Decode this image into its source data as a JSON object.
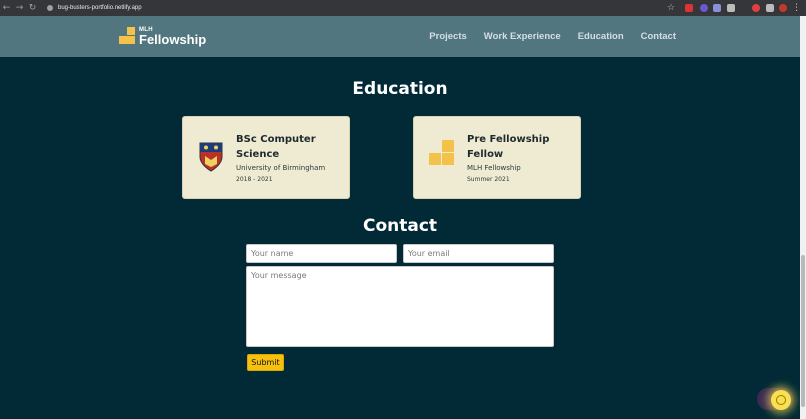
{
  "browser": {
    "url": "bug-busters-portfolio.netlify.app",
    "back_icon": "arrow-left-icon",
    "forward_icon": "arrow-right-icon",
    "reload_icon": "reload-icon",
    "star_glyph": "☆",
    "menu_glyph": "⋮"
  },
  "header": {
    "logo_small": "MLH",
    "logo_big": "Fellowship",
    "nav": [
      "Projects",
      "Work Experience",
      "Education",
      "Contact"
    ]
  },
  "education": {
    "title": "Education",
    "cards": [
      {
        "title": "BSc Computer Science",
        "institution": "University of Birmingham",
        "period": "2018 - 2021"
      },
      {
        "title": "Pre Fellowship Fellow",
        "institution": "MLH Fellowship",
        "period": "Summer 2021"
      }
    ]
  },
  "contact": {
    "title": "Contact",
    "name_placeholder": "Your name",
    "email_placeholder": "Your email",
    "message_placeholder": "Your message",
    "submit_label": "Submit"
  },
  "colors": {
    "background": "#022a36",
    "header": "#52767f",
    "card": "#eeebd2",
    "accent": "#f6c10e"
  }
}
